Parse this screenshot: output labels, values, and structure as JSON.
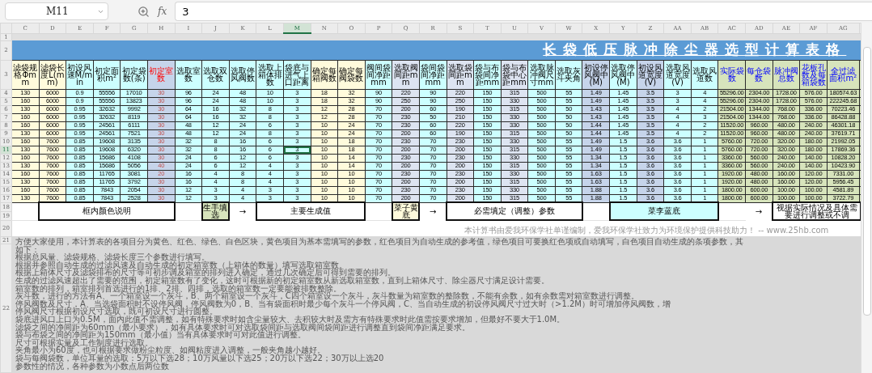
{
  "toolbar": {
    "name_box": "M11",
    "function_label": "fx",
    "formula": "3"
  },
  "sheet_rows": {
    "blank": "1",
    "title": "2",
    "header": "3",
    "legend": [
      "18",
      "19"
    ],
    "credit": "20",
    "notes": [
      "21",
      "22"
    ]
  },
  "title": "长袋低压脉冲除尘器选型计算表格",
  "columns": [
    {
      "letter": "C",
      "header": "滤袋规格Φmm",
      "color": "#fffbdc",
      "kind": "plain",
      "selected": false
    },
    {
      "letter": "D",
      "header": "滤袋长度L(mm)",
      "color": "#fffbdc",
      "kind": "plain",
      "selected": false
    },
    {
      "letter": "E",
      "header": "初设风速M/min",
      "color": "#ccffff",
      "kind": "plain",
      "selected": false
    },
    {
      "letter": "F",
      "header": "初定面积m²",
      "color": "#ccffff",
      "kind": "plain",
      "selected": false
    },
    {
      "letter": "G",
      "header": "初定袋数(条)",
      "color": "#ccffff",
      "kind": "plain",
      "selected": false
    },
    {
      "letter": "H",
      "header": "初定室数",
      "color": "#c6d4ea",
      "kind": "estimate",
      "selected": false
    },
    {
      "letter": "I",
      "header": "选取室数",
      "color": "#ccffff",
      "kind": "plain",
      "selected": false
    },
    {
      "letter": "J",
      "header": "选取双仓数",
      "color": "#ccffff",
      "kind": "plain",
      "selected": false
    },
    {
      "letter": "K",
      "header": "选取停风阀数",
      "color": "#ccffff",
      "kind": "plain",
      "selected": false
    },
    {
      "letter": "L",
      "header": "选取上箱体排数",
      "color": "#ccffff",
      "kind": "plain",
      "selected": false
    },
    {
      "letter": "M",
      "header": "袋底与进气上口距离",
      "color": "#ccffff",
      "kind": "plain",
      "selected": true
    },
    {
      "letter": "N",
      "header": "确定每箱阀数",
      "color": "#fffbdc",
      "kind": "plain",
      "selected": false
    },
    {
      "letter": "O",
      "header": "确定每阀袋数",
      "color": "#fffbdc",
      "kind": "plain",
      "selected": false
    },
    {
      "letter": "P",
      "header": "阀间袋间净距mm",
      "color": "#ccffff",
      "kind": "plain",
      "selected": false
    },
    {
      "letter": "Q",
      "header": "选取阀间距mm",
      "color": "#dde4f1",
      "kind": "plain",
      "selected": false
    },
    {
      "letter": "R",
      "header": "袋间袋间净距mm",
      "color": "#ccffff",
      "kind": "plain",
      "selected": false
    },
    {
      "letter": "S",
      "header": "选取袋间距mm",
      "color": "#dde4f1",
      "kind": "plain",
      "selected": false
    },
    {
      "letter": "T",
      "header": "袋与布袋间净距mm",
      "color": "#ccffff",
      "kind": "plain",
      "selected": false
    },
    {
      "letter": "U",
      "header": "袋与布袋中心距mm",
      "color": "#dde4f1",
      "kind": "plain",
      "selected": false
    },
    {
      "letter": "V",
      "header": "选取脉冲阀尺寸mm",
      "color": "#ccffff",
      "kind": "plain",
      "selected": false
    },
    {
      "letter": "W",
      "header": "选取灰斗夹角",
      "color": "#ccffff",
      "kind": "plain",
      "selected": false
    },
    {
      "letter": "X",
      "header": "初设停风阀中(M)",
      "color": "#c6d4ea",
      "kind": "plain",
      "selected": false
    },
    {
      "letter": "Y",
      "header": "选取停风阀中(M)",
      "color": "#ccffff",
      "kind": "plain",
      "selected": false
    },
    {
      "letter": "Z",
      "header": "初设风道宽度(V)",
      "color": "#c6d4ea",
      "kind": "plain",
      "selected": false
    },
    {
      "letter": "AA",
      "header": "选取风道宽度(V)",
      "color": "#ccffff",
      "kind": "plain",
      "selected": false
    },
    {
      "letter": "AB",
      "header": "选取风道数",
      "color": "#ccffff",
      "kind": "plain",
      "selected": false
    },
    {
      "letter": "AC",
      "header": "实际袋数",
      "color": "#d7e4bc",
      "kind": "result",
      "selected": false
    },
    {
      "letter": "AD",
      "header": "每仓袋数",
      "color": "#d7e4bc",
      "kind": "result",
      "selected": false
    },
    {
      "letter": "AE",
      "header": "脉冲阀总数",
      "color": "#d7e4bc",
      "kind": "result",
      "selected": false
    },
    {
      "letter": "AF",
      "header": "花板孔数及每箱袋数",
      "color": "#d7e4bc",
      "kind": "result",
      "selected": false
    },
    {
      "letter": "AG",
      "header": "全过滤面积m²",
      "color": "#d7e4bc",
      "kind": "result",
      "selected": false
    }
  ],
  "rows": [
    {
      "number": "4",
      "selected": false,
      "cells": [
        "130",
        "6000",
        "0.9",
        "55556",
        "17010",
        "30",
        "96",
        "24",
        "48",
        "10",
        "3",
        "18",
        "32",
        "90",
        "220",
        "90",
        "220",
        "150",
        "315",
        "500",
        "55",
        "1.49",
        "1.45",
        "3.5",
        "3",
        "4",
        "55296.00",
        "2304.00",
        "1728.00",
        "576.00",
        "180574.63"
      ]
    },
    {
      "number": "5",
      "selected": false,
      "cells": [
        "160",
        "6000",
        "0.9",
        "55556",
        "13823",
        "30",
        "96",
        "24",
        "48",
        "10",
        "3",
        "18",
        "32",
        "90",
        "250",
        "90",
        "250",
        "150",
        "330",
        "500",
        "55",
        "1.49",
        "1.45",
        "3.5",
        "3",
        "4",
        "55296.00",
        "2304.00",
        "1728.00",
        "576.00",
        "222245.68"
      ]
    },
    {
      "number": "6",
      "selected": false,
      "cells": [
        "130",
        "6000",
        "0.95",
        "32632",
        "9992",
        "30",
        "64",
        "16",
        "32",
        "8",
        "3",
        "12",
        "28",
        "70",
        "200",
        "60",
        "190",
        "150",
        "315",
        "500",
        "50",
        "1.43",
        "1.45",
        "3.5",
        "4",
        "2",
        "21504.00",
        "1344.00",
        "768.00",
        "336.00",
        "70223.46"
      ]
    },
    {
      "number": "7",
      "selected": false,
      "cells": [
        "160",
        "6000",
        "0.95",
        "32632",
        "8119",
        "30",
        "64",
        "16",
        "32",
        "8",
        "3",
        "12",
        "28",
        "70",
        "230",
        "50",
        "210",
        "150",
        "330",
        "500",
        "50",
        "1.43",
        "1.45",
        "3.5",
        "4",
        "3",
        "21504.00",
        "1344.00",
        "768.00",
        "336.00",
        "86428.88"
      ]
    },
    {
      "number": "8",
      "selected": false,
      "cells": [
        "160",
        "6000",
        "0.95",
        "24561",
        "6111",
        "30",
        "48",
        "12",
        "24",
        "6",
        "3",
        "10",
        "24",
        "70",
        "230",
        "60",
        "220",
        "150",
        "330",
        "500",
        "50",
        "1.44",
        "1.45",
        "3.5",
        "4",
        "2",
        "11520.00",
        "960.00",
        "480.00",
        "240.00",
        "46301.18"
      ]
    },
    {
      "number": "9",
      "selected": false,
      "cells": [
        "130",
        "6000",
        "0.95",
        "24561",
        "7521",
        "30",
        "48",
        "12",
        "24",
        "8",
        "3",
        "10",
        "24",
        "70",
        "200",
        "60",
        "190",
        "150",
        "315",
        "500",
        "50",
        "1.44",
        "1.45",
        "3.5",
        "4",
        "2",
        "11520.00",
        "960.00",
        "480.00",
        "240.00",
        "37619.71"
      ]
    },
    {
      "number": "10",
      "selected": false,
      "cells": [
        "160",
        "7600",
        "0.85",
        "19608",
        "3135",
        "30",
        "32",
        "8",
        "16",
        "6",
        "3",
        "10",
        "18",
        "70",
        "230",
        "70",
        "230",
        "150",
        "330",
        "500",
        "55",
        "1.49",
        "1.5",
        "3.6",
        "3.6",
        "1",
        "5760.00",
        "720.00",
        "320.00",
        "180.00",
        "21992.05"
      ]
    },
    {
      "number": "11",
      "selected": true,
      "cells": [
        "130",
        "7600",
        "0.85",
        "19608",
        "6320",
        "30",
        "32",
        "8",
        "16",
        "6",
        "3",
        "10",
        "18",
        "70",
        "200",
        "70",
        "200",
        "150",
        "315",
        "500",
        "55",
        "1.49",
        "1.5",
        "3.6",
        "3.6",
        "1",
        "5760.00",
        "720.00",
        "320.00",
        "180.00",
        "17869.36"
      ]
    },
    {
      "number": "12",
      "selected": false,
      "cells": [
        "160",
        "7600",
        "0.85",
        "15686",
        "4108",
        "30",
        "24",
        "6",
        "12",
        "6",
        "3",
        "10",
        "14",
        "70",
        "230",
        "70",
        "230",
        "150",
        "330",
        "500",
        "55",
        "1.34",
        "1.5",
        "3.6",
        "3.6",
        "1",
        "3360.00",
        "560.00",
        "240.00",
        "140.00",
        "10828.20"
      ]
    },
    {
      "number": "13",
      "selected": false,
      "cells": [
        "130",
        "7600",
        "0.85",
        "15686",
        "5056",
        "40",
        "24",
        "6",
        "12",
        "4",
        "3",
        "10",
        "14",
        "70",
        "200",
        "70",
        "200",
        "150",
        "315",
        "500",
        "55",
        "1.34",
        "1.5",
        "3.6",
        "3.6",
        "1",
        "3360.00",
        "560.00",
        "240.00",
        "140.00",
        "10423.90"
      ]
    },
    {
      "number": "14",
      "selected": false,
      "cells": [
        "160",
        "7600",
        "0.85",
        "11765",
        "3081",
        "20",
        "16",
        "4",
        "8",
        "4",
        "3",
        "10",
        "10",
        "70",
        "230",
        "70",
        "230",
        "150",
        "330",
        "500",
        "55",
        "1.63",
        "1.5",
        "3.6",
        "3.6",
        "1",
        "1920.00",
        "480.00",
        "160.00",
        "120.00",
        "7331.00"
      ]
    },
    {
      "number": "15",
      "selected": false,
      "cells": [
        "130",
        "7600",
        "0.85",
        "11765",
        "3792",
        "30",
        "16",
        "4",
        "8",
        "4",
        "3",
        "10",
        "10",
        "70",
        "200",
        "70",
        "200",
        "150",
        "315",
        "500",
        "55",
        "1.63",
        "1.5",
        "3.6",
        "3.6",
        "1",
        "1920.00",
        "480.00",
        "160.00",
        "120.00",
        "5956.45"
      ]
    },
    {
      "number": "16",
      "selected": false,
      "cells": [
        "160",
        "7600",
        "0.85",
        "7843",
        "2054",
        "30",
        "12",
        "3",
        "4",
        "3",
        "3",
        "10",
        "10",
        "70",
        "230",
        "70",
        "230",
        "150",
        "330",
        "500",
        "55",
        "1.88",
        "1.5",
        "3.6",
        "3.6",
        "1",
        "1800.00",
        "600.00",
        "100.00",
        "100.00",
        "4581.89"
      ]
    },
    {
      "number": "17",
      "selected": false,
      "cells": [
        "130",
        "7600",
        "0.85",
        "7843",
        "2528",
        "30",
        "12",
        "3",
        "4",
        "3",
        "3",
        "10",
        "10",
        "70",
        "200",
        "70",
        "200",
        "150",
        "315",
        "500",
        "55",
        "1.88",
        "1.5",
        "3.6",
        "3.6",
        "1",
        "1800.00",
        "600.00",
        "100.00",
        "100.00",
        "3722.79"
      ]
    }
  ],
  "legend": [
    {
      "kind": "label",
      "text": "框内颜色说明"
    },
    {
      "kind": "swatch",
      "text": "生手填选",
      "color": "#d7e4bc"
    },
    {
      "kind": "arrow",
      "text": "→"
    },
    {
      "kind": "label",
      "text": "主要生成值"
    },
    {
      "kind": "swatch",
      "text": "菜子黄底",
      "color": "#fffbdc"
    },
    {
      "kind": "arrow",
      "text": "→"
    },
    {
      "kind": "label",
      "text": "必需填定（调整）参数"
    },
    {
      "kind": "swatch",
      "text": "菜李蓝底",
      "color": "#ccffff"
    },
    {
      "kind": "arrow",
      "text": "→"
    },
    {
      "kind": "label",
      "text": "视据实际情况及具体需要进行调整或不调"
    }
  ],
  "credit": "本计算书由爱我环保学社单谨编制，爱我环保学社致力为环境保护提供科技助力！ -- www.25hb.com",
  "notes": [
    "方便大家使用，本计算表的各项目分为黄色、红色、绿色、白色区块，黄色项目为基本需填写的参数，红色项目为自动生成的参考值，绿色项目可要换红色项或自动填写，白色项目自动生成的条项参数，其",
    "如下：",
    "根据总风量、滤袋规格、滤袋长度三个参数进行填写。",
    "根据并参照自动生成的过滤风速及自动生成的初定箱室数（上箱体的数量）填写选取箱室数。",
    "根据上箱体尺寸及滤袋排布的尺寸等可初步调及箱室的排列进入确定，通过几次确定后可得到需要的排列。",
    "生成的过滤风速超出了需要的范围，初定箱室数有了变化，这时可根据新的初定箱室数从新选取箱室数，直到上箱体尺寸、除尘器尺寸满足设计需要。",
    "箱室数的排列，箱室排列首选进行的1排、2排、四排，选取的箱室数一定要能被排数整除。",
    "灰斗数，进行的方法有A、一个箱室设一个灰斗，B、两个箱室设一个灰斗，C四个箱室设一个灰斗，灰斗数量为箱室数的整除数，不能有余数，如有余数需对箱室数进行调整。",
    "停风阀数及尺寸，A、当选袋面积时不设停风阀，停风阀数为0，B、当有袋面积时最少每个灰斗一个停风阀，C、当自动生成的初设停风阀尺寸过大时（>1.2M）时可增加停风阀数，增",
    "停风阀尺寸根据初设尺寸选取，既可初设尺寸进行圆整。",
    "袋底进风口上口为0.5M，面内此值不需调整，如有特殊要求时如含尘量较大、去积较大时及需方有特殊要求时此值需按要求增加，但最好不要大于1.0M。",
    "滤袋之间的净间距为60mm（最小要求），如有具体要求时可对选取袋间距与选取阀间袋间距进行调整直到袋间净距满足要求。",
    "袋与布袋之间的净间距为150mm（最小值）当有具体要求时可对此值进行调整。",
    "尺寸可根据实量及工作制度进行选取。",
    "夹角最小为60度，也可根据要求做粉尘粒度、如阀粘度进入调整，一般夹角越小越好。",
    "袋与每阀袋数，单位耳量的选取：5万以下选28；10万风量以下选25；20万以下选22；30万以上选20",
    "参数性的情况，各种参数为小数点后两位数"
  ]
}
